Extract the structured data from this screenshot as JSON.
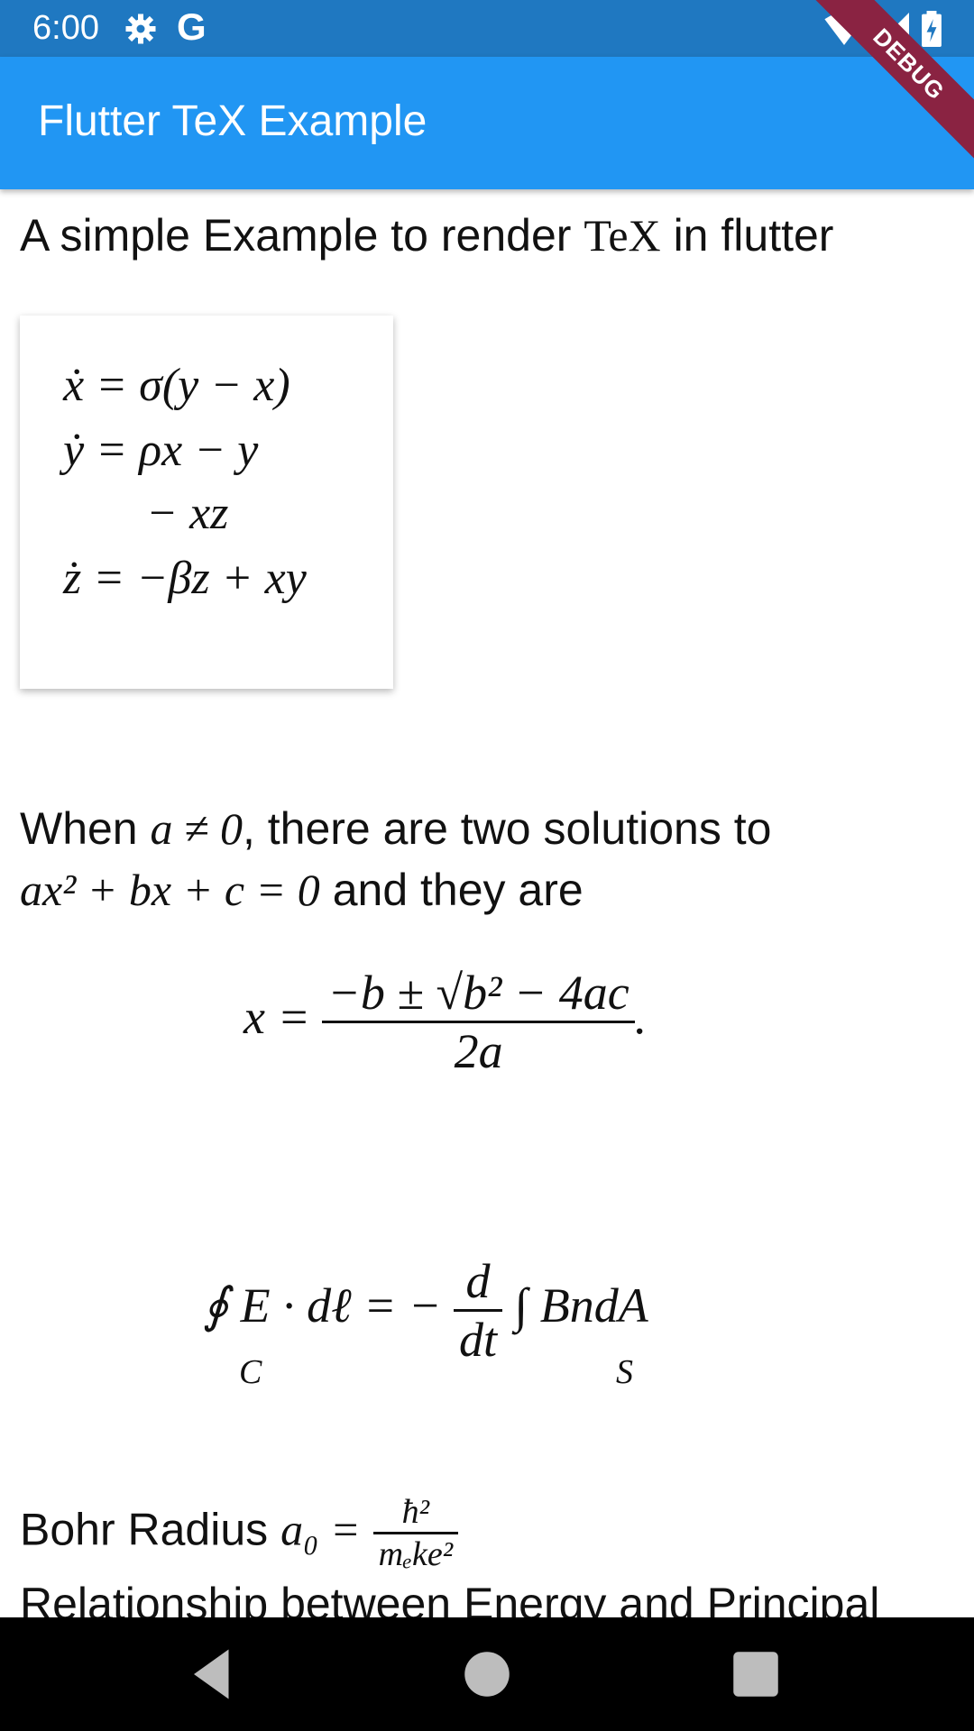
{
  "status_bar": {
    "time": "6:00",
    "google_letter": "G"
  },
  "app_bar": {
    "title": "Flutter TeX Example",
    "debug_label": "DEBUG"
  },
  "content": {
    "intro_text": "A simple Example to render",
    "intro_tex": "TeX",
    "intro_tail": "in flutter",
    "lorenz": {
      "line1": "ẋ = σ(y − x)",
      "line2": "ẏ = ρx − y",
      "line3": "− xz",
      "line4": "ż = −βz + xy"
    },
    "quadratic_intro_1a": "When",
    "quadratic_intro_1b": "a ≠ 0",
    "quadratic_intro_1c": ", there are two solutions to",
    "quadratic_intro_2a": "ax² + bx + c = 0",
    "quadratic_intro_2b": "and they are",
    "quadratic_formula": {
      "lhs": "x =",
      "numerator": "−b ± √b² − 4ac",
      "denominator": "2a",
      "tail": "."
    },
    "maxwell": {
      "lhs": "∮ E · dℓ = −",
      "frac_num": "d",
      "frac_den": "dt",
      "rhs": "∫ BndA",
      "sub_c": "C",
      "sub_s": "S"
    },
    "bohr_label": "Bohr Radius",
    "bohr_lhs": "a₀ =",
    "bohr_num": "ħ²",
    "bohr_den": "mₑke²",
    "next_line": "Relationship between Energy and Principal"
  }
}
